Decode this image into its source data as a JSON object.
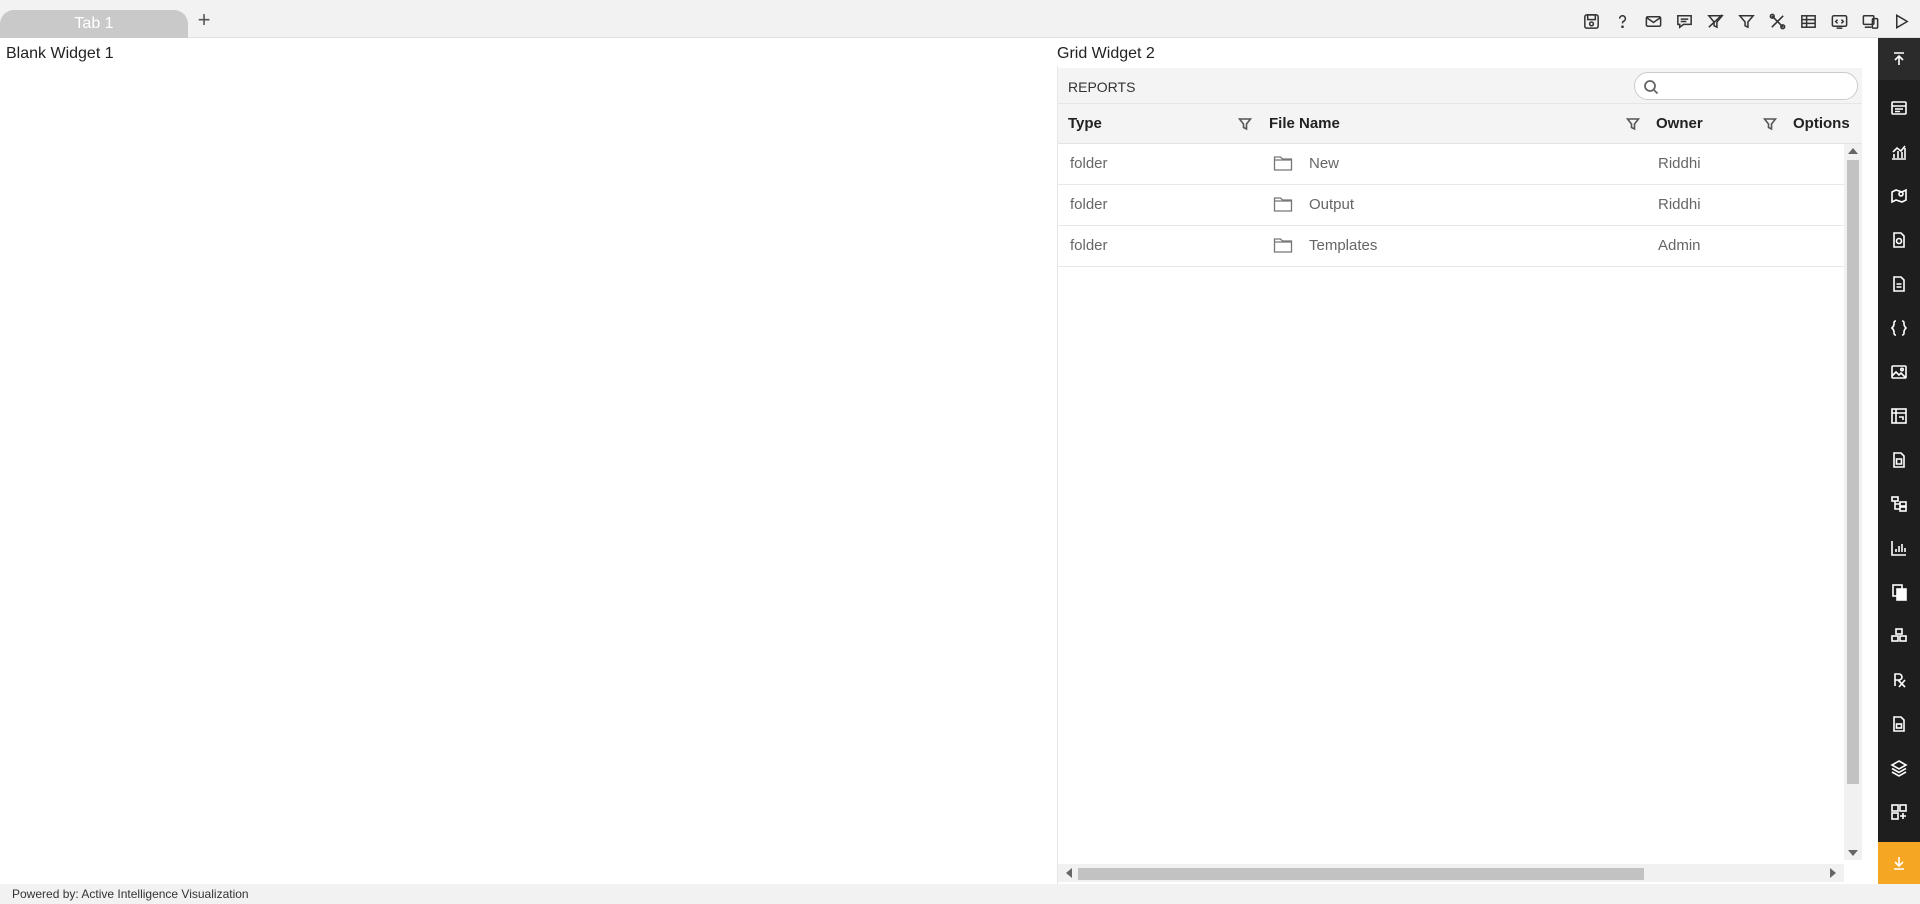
{
  "tabs": [
    {
      "label": "Tab 1"
    }
  ],
  "add_tab_label": "+",
  "toolbar_icons": [
    "save-icon",
    "help-icon",
    "email-icon",
    "comment-icon",
    "clear-filter-icon",
    "filter-icon",
    "tools-icon",
    "table-icon",
    "embed-icon",
    "devices-icon",
    "play-icon"
  ],
  "widgets": {
    "blank": {
      "title": "Blank Widget 1"
    },
    "grid": {
      "title": "Grid Widget 2",
      "caption": "REPORTS",
      "search": {
        "placeholder": "",
        "value": ""
      },
      "columns": [
        "Type",
        "File Name",
        "Owner",
        "Options"
      ],
      "rows": [
        {
          "type": "folder",
          "name": "New",
          "owner": "Riddhi"
        },
        {
          "type": "folder",
          "name": "Output",
          "owner": "Riddhi"
        },
        {
          "type": "folder",
          "name": "Templates",
          "owner": "Admin"
        }
      ]
    }
  },
  "sidebar_icons": [
    "collapse-up-icon",
    "table-widget-icon",
    "chart-icon",
    "map-icon",
    "report-icon",
    "document-icon",
    "code-icon",
    "image-icon",
    "pivot-icon",
    "file-icon",
    "tree-icon",
    "bar-chart-icon",
    "copy-icon",
    "cubes-icon",
    "formula-icon",
    "form-icon",
    "layers-icon",
    "add-widget-icon",
    "download-icon"
  ],
  "footer": {
    "text": "Powered by: Active Intelligence Visualization"
  },
  "colors": {
    "sidebar_bg": "#1e1e1e",
    "accent": "#f5a623",
    "tab_bg": "#c9c9c9"
  }
}
